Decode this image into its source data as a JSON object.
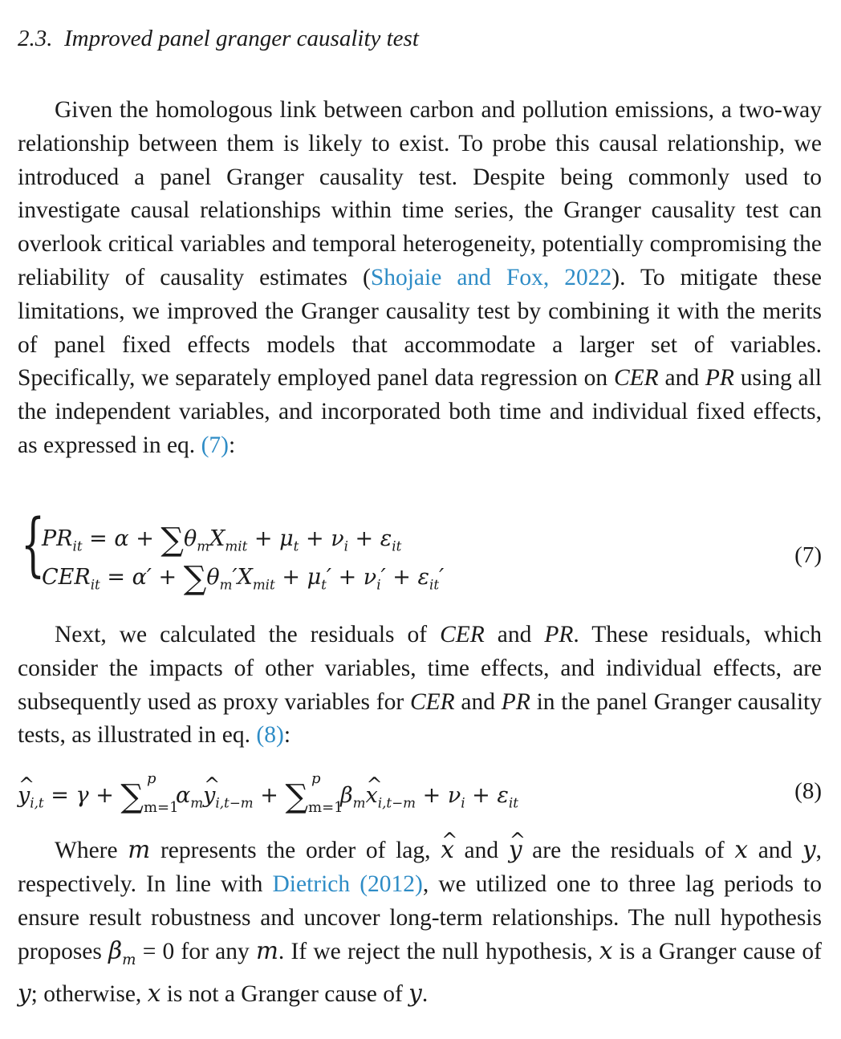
{
  "section": {
    "number": "2.3.",
    "title": "Improved panel granger causality test"
  },
  "para1": {
    "t1": "Given the homologous link between carbon and pollution emissions, a two-way relationship between them is likely to exist. To probe this causal relationship, we introduced a panel Granger causality test. Despite being commonly used to investigate causal relationships within time series, the Granger causality test can overlook critical variables and temporal heterogeneity, potentially compromising the reliability of causality estimates (",
    "cite1": "Shojaie and Fox, 2022",
    "t2": "). To mitigate these limitations, we improved the Granger causality test by combining it with the merits of panel fixed effects models that accommodate a larger set of variables. Specifically, we separately employed panel data regression on ",
    "cer": "CER",
    "and": " and ",
    "pr": "PR",
    "t3": " using all the independent variables, and incorporated both time and individual fixed effects, as expressed in eq. ",
    "eqref": "(7)",
    "t4": ":"
  },
  "eq7": {
    "number": "(7)",
    "line1_lhs": "PR",
    "line2_lhs": "CER"
  },
  "para2": {
    "t1": "Next, we calculated the residuals of ",
    "cer": "CER",
    "and": " and ",
    "pr": "PR",
    "t2": ". These residuals, which consider the impacts of other variables, time effects, and individual effects, are subsequently used as proxy variables for ",
    "cer2": "CER",
    "and2": " and ",
    "pr2": "PR",
    "t3": " in the panel Granger causality tests, as illustrated in eq. ",
    "eqref": "(8)",
    "t4": ":"
  },
  "eq8": {
    "number": "(8)"
  },
  "para3": {
    "t1": "Where ",
    "m": "m",
    "t2": " represents the order of lag, ",
    "t3": " and ",
    "t4": " are the residuals of ",
    "x": "x",
    "t5": " and ",
    "y": "y",
    "t6": ", respectively. In line with ",
    "cite": "Dietrich (2012)",
    "t7": ", we utilized one to three lag periods to ensure result robustness and uncover long-term relationships. The null hypothesis proposes ",
    "t8": " for any ",
    "t9": ". If we reject the null hypothesis, ",
    "t10": " is a Granger cause of ",
    "t11": "; otherwise, ",
    "t12": " is not a Granger cause of ",
    "t13": "."
  }
}
